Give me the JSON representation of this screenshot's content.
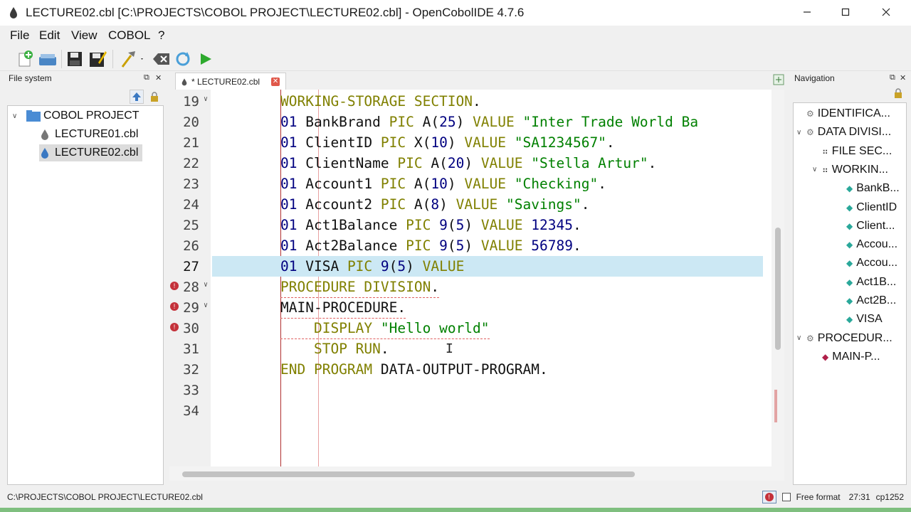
{
  "window": {
    "title": "LECTURE02.cbl [C:\\PROJECTS\\COBOL PROJECT\\LECTURE02.cbl] - OpenCobolIDE 4.7.6",
    "minimize_icon": "minimize-icon",
    "maximize_icon": "maximize-icon",
    "close_icon": "close-icon"
  },
  "menu": [
    "File",
    "Edit",
    "View",
    "COBOL",
    "?"
  ],
  "toolbar": {
    "icons": [
      "new-file-icon",
      "open-icon",
      "save-icon",
      "save-as-icon",
      "compile-icon",
      "clean-icon",
      "rebuild-icon",
      "run-icon"
    ]
  },
  "file_system": {
    "title": "File system",
    "root": "COBOL PROJECT",
    "files": [
      "LECTURE01.cbl",
      "LECTURE02.cbl"
    ],
    "selected": "LECTURE02.cbl"
  },
  "editor": {
    "tab_label": "* LECTURE02.cbl",
    "lines": [
      {
        "n": "19",
        "fold": true,
        "error": false,
        "current": false
      },
      {
        "n": "20",
        "fold": false,
        "error": false,
        "current": false
      },
      {
        "n": "21",
        "fold": false,
        "error": false,
        "current": false
      },
      {
        "n": "22",
        "fold": false,
        "error": false,
        "current": false
      },
      {
        "n": "23",
        "fold": false,
        "error": false,
        "current": false
      },
      {
        "n": "24",
        "fold": false,
        "error": false,
        "current": false
      },
      {
        "n": "25",
        "fold": false,
        "error": false,
        "current": false
      },
      {
        "n": "26",
        "fold": false,
        "error": false,
        "current": false
      },
      {
        "n": "27",
        "fold": false,
        "error": false,
        "current": true
      },
      {
        "n": "28",
        "fold": true,
        "error": true,
        "current": false
      },
      {
        "n": "29",
        "fold": true,
        "error": true,
        "current": false
      },
      {
        "n": "30",
        "fold": false,
        "error": true,
        "current": false
      },
      {
        "n": "31",
        "fold": false,
        "error": false,
        "current": false
      },
      {
        "n": "32",
        "fold": false,
        "error": false,
        "current": false
      },
      {
        "n": "33",
        "fold": false,
        "error": false,
        "current": false
      },
      {
        "n": "34",
        "fold": false,
        "error": false,
        "current": false
      }
    ],
    "code": [
      [
        [
          "k",
          "WORKING-STORAGE SECTION"
        ],
        [
          "i",
          "."
        ]
      ],
      [
        [
          "n",
          "01"
        ],
        [
          "i",
          " BankBrand "
        ],
        [
          "k",
          "PIC"
        ],
        [
          "i",
          " A("
        ],
        [
          "n",
          "25"
        ],
        [
          "i",
          ") "
        ],
        [
          "k",
          "VALUE"
        ],
        [
          "i",
          " "
        ],
        [
          "s",
          "\"Inter Trade World Ba"
        ]
      ],
      [
        [
          "n",
          "01"
        ],
        [
          "i",
          " ClientID "
        ],
        [
          "k",
          "PIC"
        ],
        [
          "i",
          " X("
        ],
        [
          "n",
          "10"
        ],
        [
          "i",
          ") "
        ],
        [
          "k",
          "VALUE"
        ],
        [
          "i",
          " "
        ],
        [
          "s",
          "\"SA1234567\""
        ],
        [
          "i",
          "."
        ]
      ],
      [
        [
          "n",
          "01"
        ],
        [
          "i",
          " ClientName "
        ],
        [
          "k",
          "PIC"
        ],
        [
          "i",
          " A("
        ],
        [
          "n",
          "20"
        ],
        [
          "i",
          ") "
        ],
        [
          "k",
          "VALUE"
        ],
        [
          "i",
          " "
        ],
        [
          "s",
          "\"Stella Artur\""
        ],
        [
          "i",
          "."
        ]
      ],
      [
        [
          "n",
          "01"
        ],
        [
          "i",
          " Account1 "
        ],
        [
          "k",
          "PIC"
        ],
        [
          "i",
          " A("
        ],
        [
          "n",
          "10"
        ],
        [
          "i",
          ") "
        ],
        [
          "k",
          "VALUE"
        ],
        [
          "i",
          " "
        ],
        [
          "s",
          "\"Checking\""
        ],
        [
          "i",
          "."
        ]
      ],
      [
        [
          "n",
          "01"
        ],
        [
          "i",
          " Account2 "
        ],
        [
          "k",
          "PIC"
        ],
        [
          "i",
          " A("
        ],
        [
          "n",
          "8"
        ],
        [
          "i",
          ") "
        ],
        [
          "k",
          "VALUE"
        ],
        [
          "i",
          " "
        ],
        [
          "s",
          "\"Savings\""
        ],
        [
          "i",
          "."
        ]
      ],
      [
        [
          "n",
          "01"
        ],
        [
          "i",
          " Act1Balance "
        ],
        [
          "k",
          "PIC"
        ],
        [
          "i",
          " "
        ],
        [
          "n",
          "9"
        ],
        [
          "i",
          "("
        ],
        [
          "n",
          "5"
        ],
        [
          "i",
          ") "
        ],
        [
          "k",
          "VALUE"
        ],
        [
          "i",
          " "
        ],
        [
          "n",
          "12345"
        ],
        [
          "i",
          "."
        ]
      ],
      [
        [
          "n",
          "01"
        ],
        [
          "i",
          " Act2Balance "
        ],
        [
          "k",
          "PIC"
        ],
        [
          "i",
          " "
        ],
        [
          "n",
          "9"
        ],
        [
          "i",
          "("
        ],
        [
          "n",
          "5"
        ],
        [
          "i",
          ") "
        ],
        [
          "k",
          "VALUE"
        ],
        [
          "i",
          " "
        ],
        [
          "n",
          "56789"
        ],
        [
          "i",
          "."
        ]
      ],
      [
        [
          "n",
          "01"
        ],
        [
          "i",
          " VISA "
        ],
        [
          "k",
          "PIC"
        ],
        [
          "i",
          " "
        ],
        [
          "n",
          "9"
        ],
        [
          "i",
          "("
        ],
        [
          "n",
          "5"
        ],
        [
          "i",
          ") "
        ],
        [
          "k",
          "VALUE"
        ]
      ],
      [
        [
          "k",
          "PROCEDURE DIVISION"
        ],
        [
          "i",
          "."
        ]
      ],
      [
        [
          "i",
          "MAIN-PROCEDURE."
        ]
      ],
      [
        [
          "i",
          "    "
        ],
        [
          "k",
          "DISPLAY"
        ],
        [
          "i",
          " "
        ],
        [
          "s",
          "\"Hello world\""
        ]
      ],
      [
        [
          "i",
          "    "
        ],
        [
          "k",
          "STOP RUN"
        ],
        [
          "i",
          "."
        ]
      ],
      [
        [
          "k",
          "END PROGRAM"
        ],
        [
          "i",
          " DATA-OUTPUT-PROGRAM."
        ]
      ],
      [],
      []
    ]
  },
  "navigation": {
    "title": "Navigation",
    "items": [
      {
        "label": "IDENTIFICA...",
        "indent": 0,
        "icon": "division-icon",
        "expand": ""
      },
      {
        "label": "DATA DIVISI...",
        "indent": 0,
        "icon": "division-icon",
        "expand": "v"
      },
      {
        "label": "FILE SEC...",
        "indent": 1,
        "icon": "section-icon",
        "expand": ""
      },
      {
        "label": "WORKIN...",
        "indent": 1,
        "icon": "section-icon",
        "expand": "v"
      },
      {
        "label": "BankB...",
        "indent": 2,
        "icon": "variable-icon",
        "expand": ""
      },
      {
        "label": "ClientID",
        "indent": 2,
        "icon": "variable-icon",
        "expand": ""
      },
      {
        "label": "Client...",
        "indent": 2,
        "icon": "variable-icon",
        "expand": ""
      },
      {
        "label": "Accou...",
        "indent": 2,
        "icon": "variable-icon",
        "expand": ""
      },
      {
        "label": "Accou...",
        "indent": 2,
        "icon": "variable-icon",
        "expand": ""
      },
      {
        "label": "Act1B...",
        "indent": 2,
        "icon": "variable-icon",
        "expand": ""
      },
      {
        "label": "Act2B...",
        "indent": 2,
        "icon": "variable-icon",
        "expand": ""
      },
      {
        "label": "VISA",
        "indent": 2,
        "icon": "variable-icon",
        "expand": ""
      },
      {
        "label": "PROCEDUR...",
        "indent": 0,
        "icon": "division-icon",
        "expand": "v"
      },
      {
        "label": "MAIN-P...",
        "indent": 1,
        "icon": "paragraph-icon",
        "expand": ""
      }
    ]
  },
  "status": {
    "path": "C:\\PROJECTS\\COBOL PROJECT\\LECTURE02.cbl",
    "free_format_label": "Free format",
    "free_format_checked": false,
    "position": "27:31",
    "encoding": "cp1252"
  },
  "colors": {
    "keyword": "#808000",
    "string": "#008000",
    "number": "#000080",
    "current_line": "#cce8f4",
    "error": "#c4313a"
  }
}
